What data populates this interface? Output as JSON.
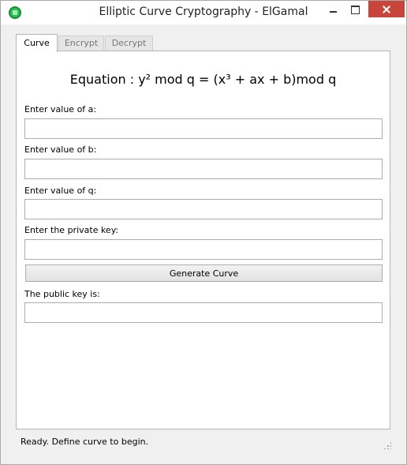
{
  "window": {
    "title": "Elliptic Curve Cryptography - ElGamal"
  },
  "tabs": [
    {
      "label": "Curve",
      "active": true
    },
    {
      "label": "Encrypt",
      "active": false
    },
    {
      "label": "Decrypt",
      "active": false
    }
  ],
  "curve": {
    "equation": "Equation : y² mod q = (x³ + ax + b)mod q",
    "a_label": "Enter value of a:",
    "a_value": "",
    "b_label": "Enter value of b:",
    "b_value": "",
    "q_label": "Enter value of q:",
    "q_value": "",
    "private_key_label": "Enter the private key:",
    "private_key_value": "",
    "generate_button": "Generate Curve",
    "public_key_label": "The public key is:",
    "public_key_value": ""
  },
  "status_bar": {
    "text": "Ready. Define curve to begin."
  },
  "colors": {
    "close_button": "#c7453a",
    "app_icon": "#2fbf57"
  }
}
